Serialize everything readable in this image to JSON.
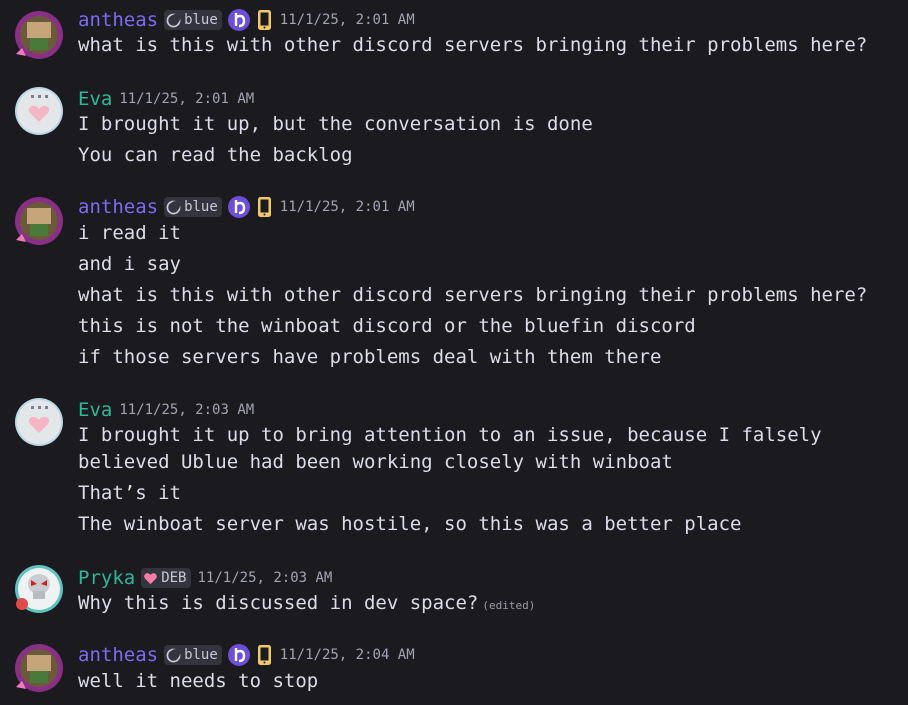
{
  "colors": {
    "background": "#1a1a1f",
    "antheas_name": "#7b6cf2",
    "eva_name": "#2fb89b",
    "pryka_name": "#2fb89b",
    "text": "#dcdde8",
    "timestamp": "#a3a4b2"
  },
  "messages": [
    {
      "author": "antheas",
      "tag": "blue",
      "timestamp": "11/1/25, 2:01 AM",
      "lines": [
        "what is this with other discord servers bringing their problems here?"
      ]
    },
    {
      "author": "Eva",
      "timestamp": "11/1/25, 2:01 AM",
      "lines": [
        "I brought it up, but the conversation is done",
        "You can read the backlog"
      ]
    },
    {
      "author": "antheas",
      "tag": "blue",
      "timestamp": "11/1/25, 2:01 AM",
      "lines": [
        "i read it",
        "and i say",
        "what is this with other discord servers bringing their problems here?",
        "this is not the winboat discord or the bluefin discord",
        "if those servers have problems deal with them there"
      ]
    },
    {
      "author": "Eva",
      "timestamp": "11/1/25, 2:03 AM",
      "lines": [
        "I brought it up to bring attention to an issue, because I falsely",
        "believed Ublue had been working closely with winboat",
        "That’s it",
        "The winboat server was hostile, so this was a better place"
      ]
    },
    {
      "author": "Pryka",
      "tag": "DEB",
      "timestamp": "11/1/25, 2:03 AM",
      "lines": [
        "Why this is discussed in dev space?"
      ],
      "edited": "(edited)"
    },
    {
      "author": "antheas",
      "tag": "blue",
      "timestamp": "11/1/25, 2:04 AM",
      "lines": [
        "well it needs to stop"
      ]
    }
  ]
}
